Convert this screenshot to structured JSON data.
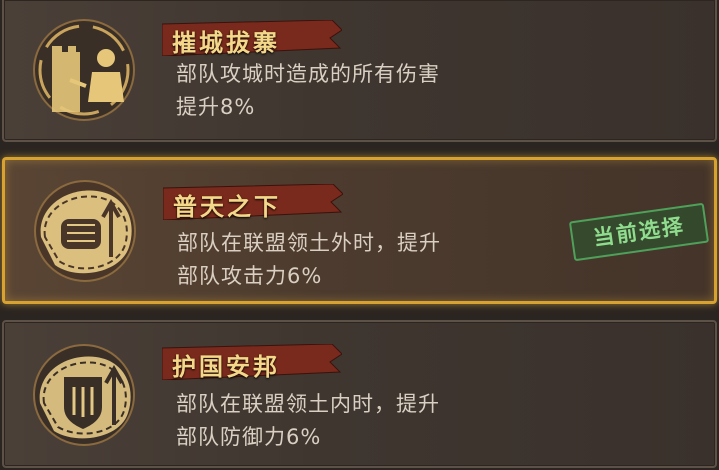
{
  "skills": [
    {
      "title": "摧城拔寨",
      "desc_line1": "部队攻城时造成的所有伤害",
      "desc_line2": "提升8%",
      "icon": "castle-warrior-icon",
      "selected": false
    },
    {
      "title": "普天之下",
      "desc_line1": "部队在联盟领土外时，提升",
      "desc_line2": "部队攻击力6%",
      "icon": "fist-icon",
      "selected": true,
      "badge": "当前选择"
    },
    {
      "title": "护国安邦",
      "desc_line1": "部队在联盟领土内时，提升",
      "desc_line2": "部队防御力6%",
      "icon": "shield-icon",
      "selected": false
    }
  ],
  "colors": {
    "title_gold": "#f4d88a",
    "banner_red": "#7a2a1c",
    "selected_border": "#d8a230",
    "badge_green": "#8fdc8f",
    "text": "#d9cfc2"
  }
}
